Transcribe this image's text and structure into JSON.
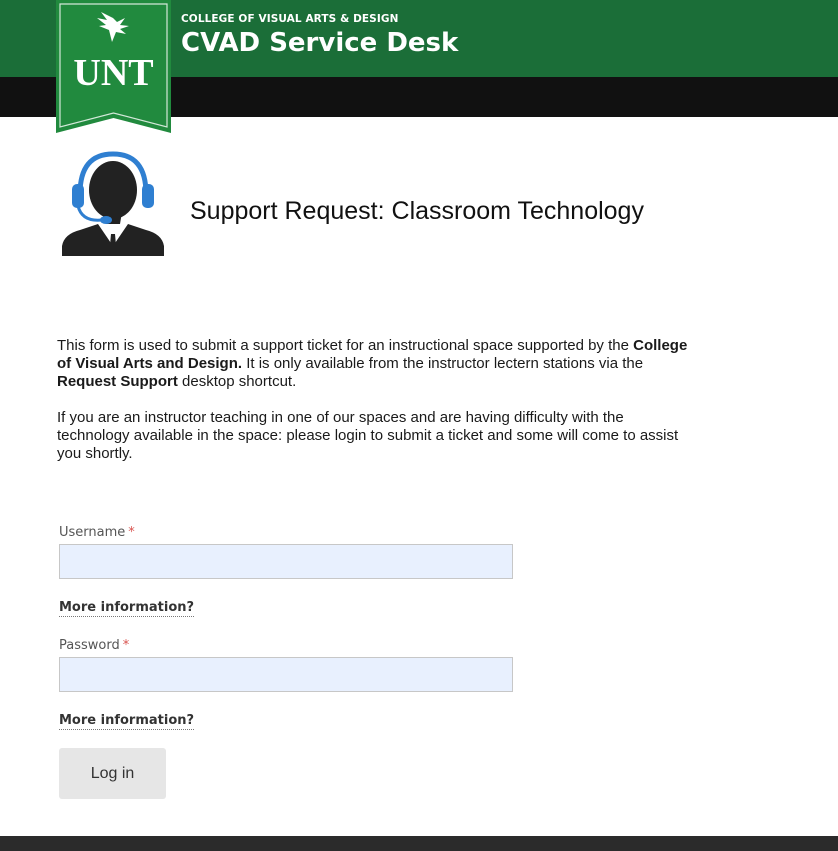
{
  "header": {
    "subtitle": "COLLEGE OF VISUAL ARTS & DESIGN",
    "title": "CVAD Service Desk",
    "logo_text": "UNT",
    "logo_icon": "eagle-icon",
    "colors": {
      "brand_green": "#1b6e38",
      "logo_green": "#218a3e",
      "bar_black": "#111111"
    }
  },
  "page": {
    "heading": "Support Request: Classroom Technology",
    "agent_icon": "support-agent-headset-icon"
  },
  "intro": {
    "p1_part1": "This form is used to submit a support ticket for an instructional space supported by the ",
    "p1_bold1": "College of Visual Arts and Design.",
    "p1_part2": "  It is only available from the instructor lectern stations via the ",
    "p1_bold2": "Request Support",
    "p1_part3": " desktop shortcut.",
    "p2": "If you are an instructor teaching in one of our spaces and are having difficulty with the technology available in the space: please login to submit a ticket and some will come to assist you shortly."
  },
  "form": {
    "username_label": "Username",
    "username_value": "",
    "password_label": "Password",
    "password_value": "",
    "required_marker": "*",
    "more_info_label": "More information?",
    "login_label": "Log in"
  }
}
